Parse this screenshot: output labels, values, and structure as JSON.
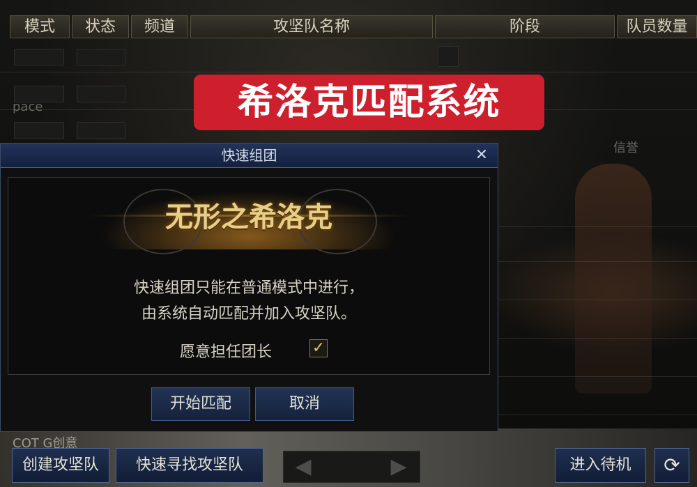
{
  "table": {
    "headers": [
      "模式",
      "状态",
      "频道",
      "攻坚队名称",
      "阶段",
      "队员数量"
    ]
  },
  "background": {
    "text_left": "pace",
    "text_right": "信誉"
  },
  "banner": {
    "text": "希洛克匹配系统"
  },
  "dialog": {
    "title": "快速组团",
    "close_symbol": "✕",
    "emblem_title": "无形之希洛克",
    "description_line1": "快速组团只能在普通模式中进行，",
    "description_line2": "由系统自动匹配并加入攻坚队。",
    "volunteer_label": "愿意担任团长",
    "volunteer_checked": true,
    "check_symbol": "✓",
    "start_button": "开始匹配",
    "cancel_button": "取消"
  },
  "bottom_bar": {
    "partial_text": "COT G创意",
    "create_button": "创建攻坚队",
    "search_button": "快速寻找攻坚队",
    "prev_symbol": "◀",
    "next_symbol": "▶",
    "standby_button": "进入待机",
    "refresh_symbol": "⟳"
  },
  "colors": {
    "banner_bg": "#cd1f2c",
    "dialog_title_bg": "#1a2a4c",
    "button_bg": "#1b2a48",
    "emblem_gold": "#e7cf8a"
  }
}
